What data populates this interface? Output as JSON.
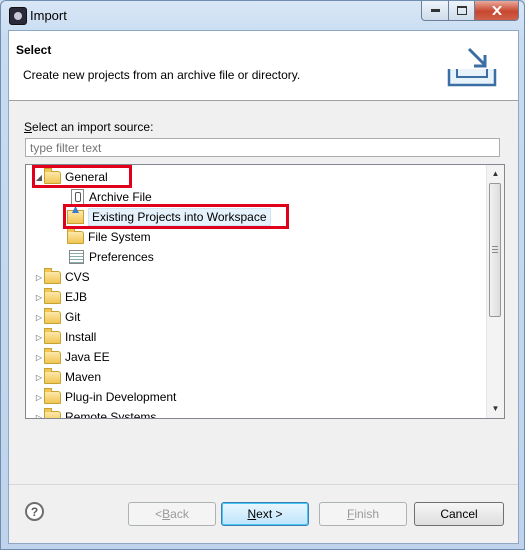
{
  "window": {
    "title": "Import"
  },
  "header": {
    "title": "Select",
    "description": "Create new projects from an archive file or directory."
  },
  "source_label": {
    "pre": "",
    "mnemonic": "S",
    "post": "elect an import source:"
  },
  "filter": {
    "placeholder": "type filter text",
    "value": ""
  },
  "tree": {
    "items": [
      {
        "label": "General",
        "level": 0,
        "expanded": true,
        "icon": "folder-open-icon"
      },
      {
        "label": "Archive File",
        "level": 1,
        "icon": "archive-file-icon"
      },
      {
        "label": "Existing Projects into Workspace",
        "level": 1,
        "icon": "project-import-icon",
        "selected": true
      },
      {
        "label": "File System",
        "level": 1,
        "icon": "folder-icon"
      },
      {
        "label": "Preferences",
        "level": 1,
        "icon": "preferences-icon"
      },
      {
        "label": "CVS",
        "level": 0,
        "icon": "folder-icon"
      },
      {
        "label": "EJB",
        "level": 0,
        "icon": "folder-icon"
      },
      {
        "label": "Git",
        "level": 0,
        "icon": "folder-icon"
      },
      {
        "label": "Install",
        "level": 0,
        "icon": "folder-icon"
      },
      {
        "label": "Java EE",
        "level": 0,
        "icon": "folder-icon"
      },
      {
        "label": "Maven",
        "level": 0,
        "icon": "folder-icon"
      },
      {
        "label": "Plug-in Development",
        "level": 0,
        "icon": "folder-icon"
      },
      {
        "label": "Remote Systems",
        "level": 0,
        "icon": "folder-icon"
      }
    ]
  },
  "buttons": {
    "back": {
      "pre": "< ",
      "mnemonic": "B",
      "post": "ack",
      "enabled": false
    },
    "next": {
      "pre": "",
      "mnemonic": "N",
      "post": "ext >",
      "enabled": true
    },
    "finish": {
      "pre": "",
      "mnemonic": "F",
      "post": "inish",
      "enabled": false
    },
    "cancel": {
      "label": "Cancel",
      "enabled": true
    }
  },
  "colors": {
    "highlight_box": "#e0001c",
    "selection_bg": "#e5f1fb"
  }
}
